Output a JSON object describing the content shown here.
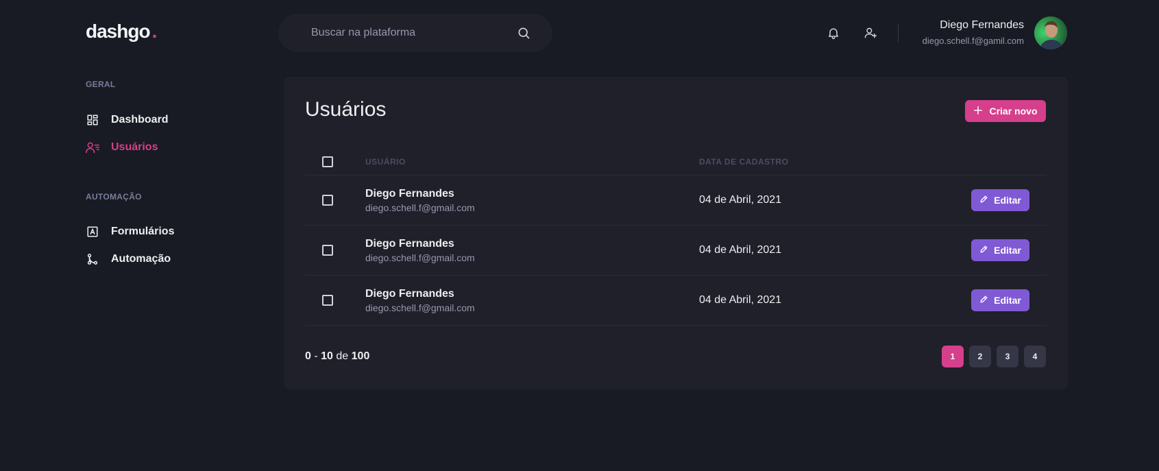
{
  "header": {
    "logo_text": "dashgo",
    "logo_dot": ".",
    "search_placeholder": "Buscar na plataforma",
    "profile_name": "Diego Fernandes",
    "profile_email": "diego.schell.f@gamil.com",
    "icons": [
      "bell-icon",
      "user-add-icon",
      "search-icon"
    ]
  },
  "sidebar": {
    "sections": [
      {
        "title": "GERAL",
        "items": [
          {
            "label": "Dashboard",
            "icon": "dashboard-icon",
            "active": false
          },
          {
            "label": "Usuários",
            "icon": "users-icon",
            "active": true
          }
        ]
      },
      {
        "title": "AUTOMAÇÃO",
        "items": [
          {
            "label": "Formulários",
            "icon": "form-icon",
            "active": false
          },
          {
            "label": "Automação",
            "icon": "git-merge-icon",
            "active": false
          }
        ]
      }
    ]
  },
  "main": {
    "title": "Usuários",
    "create_button": "Criar novo",
    "columns": [
      "USUÁRIO",
      "DATA DE CADASTRO"
    ],
    "rows": [
      {
        "name": "Diego Fernandes",
        "email": "diego.schell.f@gmail.com",
        "date": "04 de Abril, 2021",
        "action": "Editar"
      },
      {
        "name": "Diego Fernandes",
        "email": "diego.schell.f@gmail.com",
        "date": "04 de Abril, 2021",
        "action": "Editar"
      },
      {
        "name": "Diego Fernandes",
        "email": "diego.schell.f@gmail.com",
        "date": "04 de Abril, 2021",
        "action": "Editar"
      }
    ],
    "pagination": {
      "range_start": "0",
      "separator": "-",
      "range_end": "10",
      "of_label": "de",
      "total": "100",
      "pages": [
        "1",
        "2",
        "3",
        "4"
      ],
      "current": "1"
    }
  },
  "colors": {
    "background": "#181B23",
    "card": "#1F2029",
    "accent_pink": "#D53F8C",
    "accent_purple": "#805AD5",
    "muted_text": "#9699B0"
  }
}
